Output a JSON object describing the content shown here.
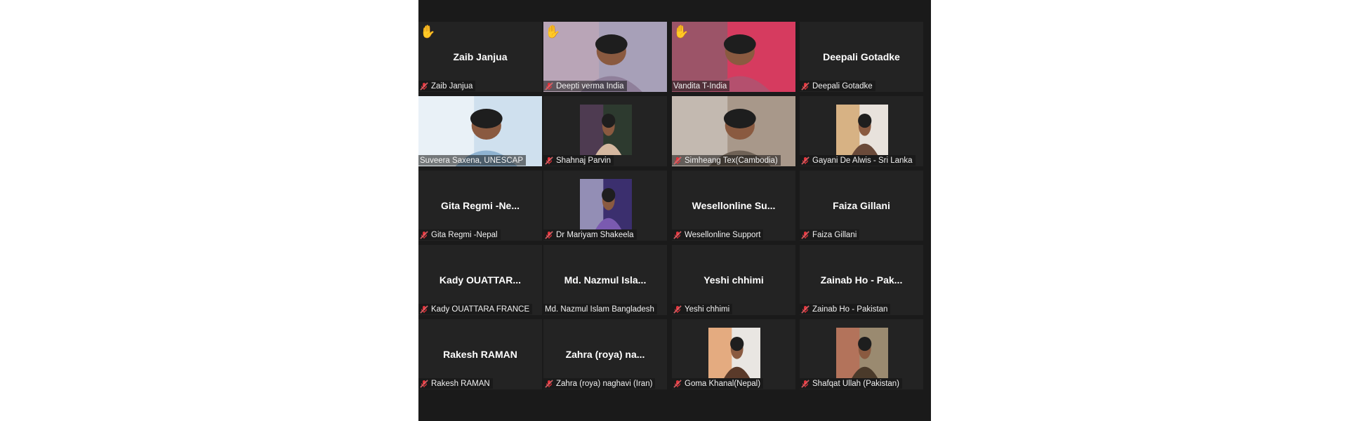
{
  "meeting": {
    "tiles": [
      {
        "label": "Zaib Janjua",
        "name": "Zaib Janjua",
        "muted": true,
        "hand": true,
        "video": "none"
      },
      {
        "label": "",
        "name": "Deepti verma India",
        "muted": true,
        "hand": true,
        "video": "full",
        "bg": [
          "#a7a0b8",
          "#c9a9b6",
          "#8f7f9a"
        ]
      },
      {
        "label": "",
        "name": "Vandita T-India",
        "muted": false,
        "hand": true,
        "video": "full",
        "active": true,
        "bg": [
          "#d63b5f",
          "#6e6a70",
          "#b4506e"
        ]
      },
      {
        "label": "Deepali Gotadke",
        "name": "Deepali Gotadke",
        "muted": true,
        "hand": false,
        "video": "none"
      },
      {
        "label": "",
        "name": "Suveera Saxena, UNESCAP",
        "muted": false,
        "hand": false,
        "video": "full",
        "bg": [
          "#cfe0ee",
          "#ffffff",
          "#8fb3d1"
        ]
      },
      {
        "label": "",
        "name": "Shahnaj Parvin",
        "muted": true,
        "hand": false,
        "video": "thumb",
        "bg": [
          "#2d3a2f",
          "#6a3d6e",
          "#d5b8a0"
        ]
      },
      {
        "label": "",
        "name": "Simheang Tex(Cambodia)",
        "muted": true,
        "hand": false,
        "video": "full",
        "bg": [
          "#a8988a",
          "#d9d6cf",
          "#6f6256"
        ]
      },
      {
        "label": "",
        "name": "Gayani De Alwis - Sri Lanka",
        "muted": true,
        "hand": false,
        "video": "thumb",
        "bg": [
          "#e8e2dc",
          "#c88a3c",
          "#6a4a3a"
        ]
      },
      {
        "label": "Gita Regmi -Ne...",
        "name": "Gita Regmi -Nepal",
        "muted": true,
        "hand": false,
        "video": "none"
      },
      {
        "label": "",
        "name": "Dr Mariyam Shakeela",
        "muted": true,
        "hand": false,
        "video": "thumb",
        "bg": [
          "#3b2f6e",
          "#dcdcf0",
          "#7a5ab0"
        ]
      },
      {
        "label": "Wesellonline Su...",
        "name": "Wesellonline Support",
        "muted": true,
        "hand": false,
        "video": "none"
      },
      {
        "label": "Faiza Gillani",
        "name": "Faiza Gillani",
        "muted": true,
        "hand": false,
        "video": "none"
      },
      {
        "label": "Kady OUATTAR...",
        "name": "Kady OUATTARA FRANCE",
        "muted": true,
        "hand": false,
        "video": "none"
      },
      {
        "label": "Md. Nazmul Isla...",
        "name": "Md. Nazmul Islam Bangladesh",
        "muted": false,
        "hand": false,
        "video": "none"
      },
      {
        "label": "Yeshi chhimi",
        "name": "Yeshi chhimi",
        "muted": true,
        "hand": false,
        "video": "none"
      },
      {
        "label": "Zainab Ho - Pak...",
        "name": "Zainab Ho - Pakistan",
        "muted": true,
        "hand": false,
        "video": "none"
      },
      {
        "label": "Rakesh RAMAN",
        "name": "Rakesh RAMAN",
        "muted": true,
        "hand": false,
        "video": "none"
      },
      {
        "label": "Zahra (roya) na...",
        "name": "Zahra (roya) naghavi (Iran)",
        "muted": true,
        "hand": false,
        "video": "none"
      },
      {
        "label": "",
        "name": "Goma Khanal(Nepal)",
        "muted": true,
        "hand": false,
        "video": "thumb",
        "bg": [
          "#e9e6e2",
          "#e07a30",
          "#5a3a2a"
        ]
      },
      {
        "label": "",
        "name": "Shafqat Ullah (Pakistan)",
        "muted": true,
        "hand": false,
        "video": "thumb",
        "bg": [
          "#9a8a70",
          "#c8604a",
          "#4a3a2a"
        ]
      }
    ]
  },
  "colors": {
    "muted": "#e2323a",
    "hand": "#f5c542",
    "active_border": "#c9e36b"
  },
  "icons": {
    "muted": "microphone-muted-icon",
    "hand": "raised-hand-icon"
  }
}
